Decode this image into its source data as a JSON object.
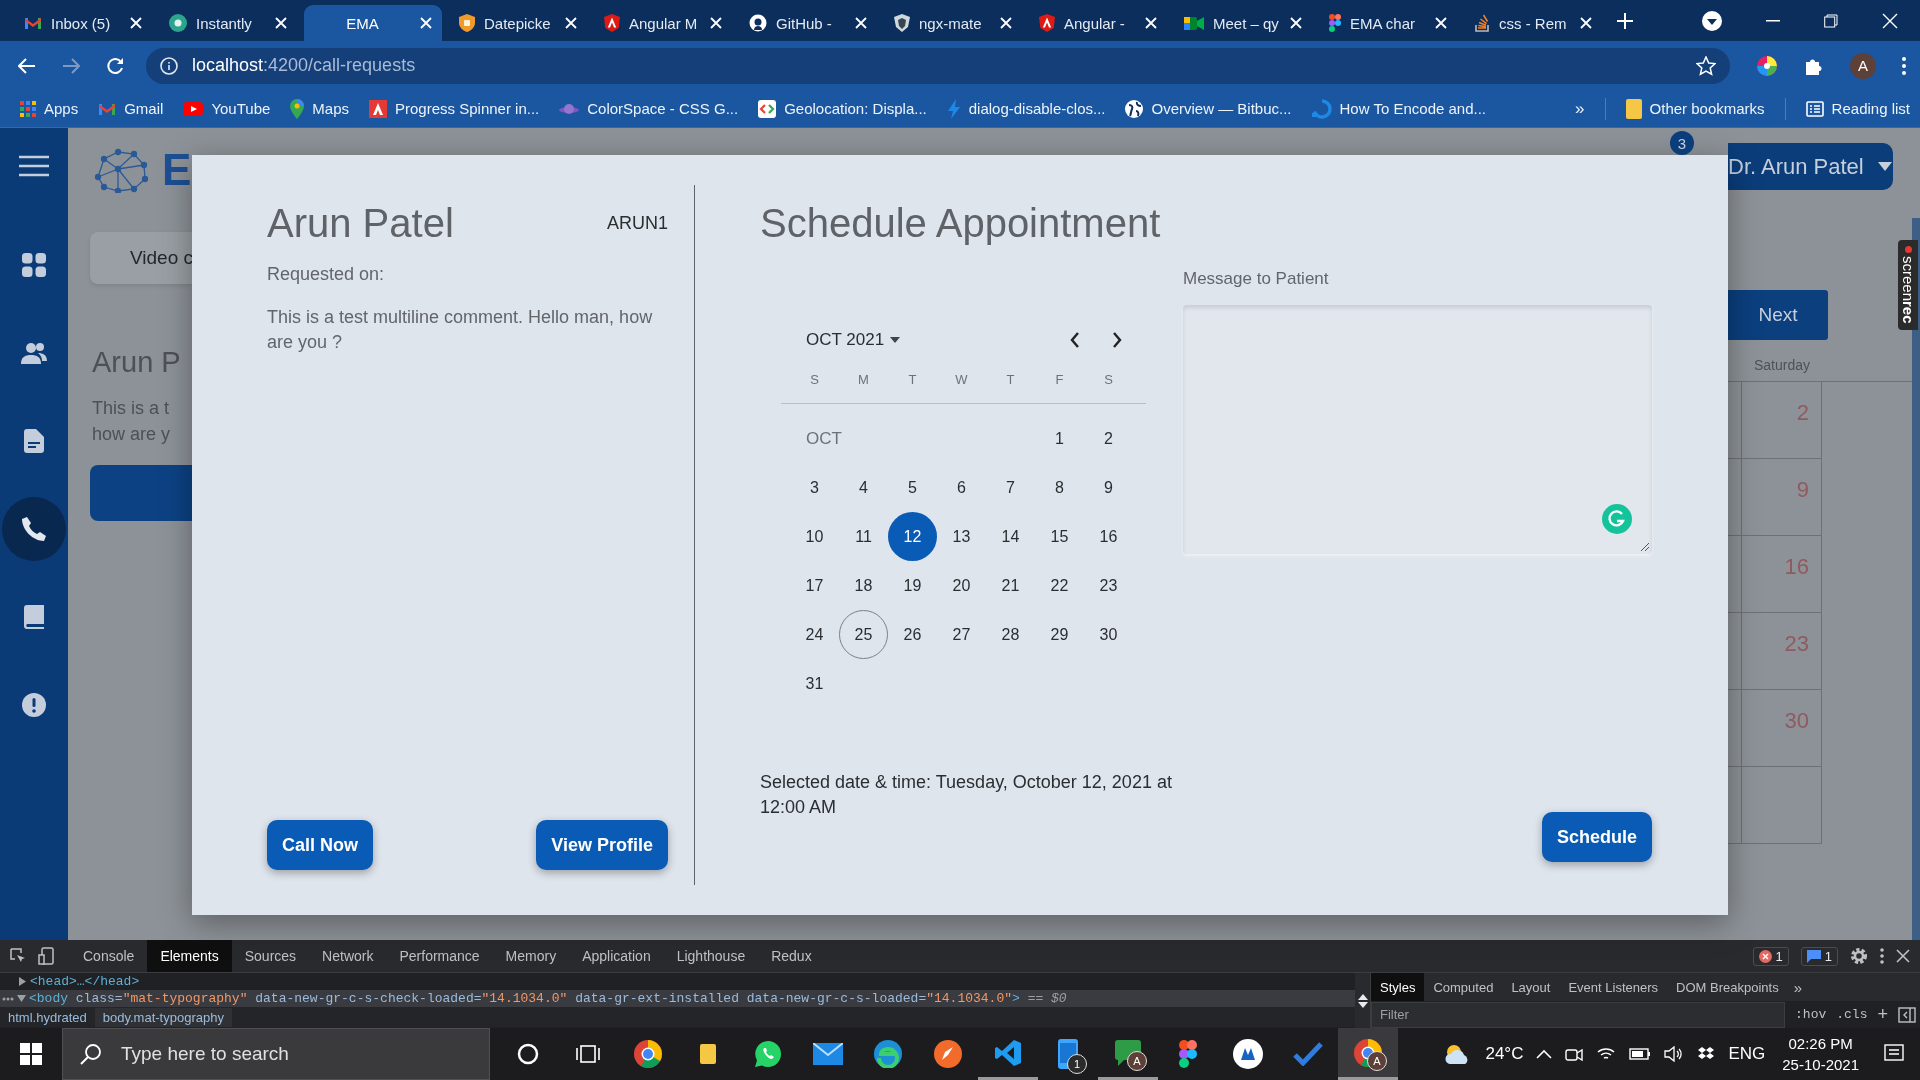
{
  "browser": {
    "tabs": [
      {
        "title": "Inbox (5)",
        "kind": "gmail",
        "selected": false
      },
      {
        "title": "Instantly",
        "kind": "qt",
        "selected": false
      },
      {
        "title": "EMA",
        "kind": "none",
        "selected": true
      },
      {
        "title": "Datepicke",
        "kind": "shield",
        "selected": false
      },
      {
        "title": "Angular M",
        "kind": "angular",
        "selected": false
      },
      {
        "title": "GitHub -",
        "kind": "github",
        "selected": false
      },
      {
        "title": "ngx-mate",
        "kind": "ngx",
        "selected": false
      },
      {
        "title": "Angular -",
        "kind": "angular",
        "selected": false
      },
      {
        "title": "Meet – qy",
        "kind": "meet",
        "selected": false
      },
      {
        "title": "EMA char",
        "kind": "figma",
        "selected": false
      },
      {
        "title": "css - Rem",
        "kind": "stack",
        "selected": false
      }
    ],
    "url_host": "localhost",
    "url_rest": ":4200/call-requests",
    "profile_initial": "A",
    "bookmarks": [
      {
        "label": "Apps",
        "kind": "apps"
      },
      {
        "label": "Gmail",
        "kind": "gmail"
      },
      {
        "label": "YouTube",
        "kind": "youtube"
      },
      {
        "label": "Maps",
        "kind": "maps"
      },
      {
        "label": "Progress Spinner in...",
        "kind": "doc"
      },
      {
        "label": "ColorSpace - CSS G...",
        "kind": "planet"
      },
      {
        "label": "Geolocation: Displa...",
        "kind": "code"
      },
      {
        "label": "dialog-disable-clos...",
        "kind": "bolt"
      },
      {
        "label": "Overview — Bitbuc...",
        "kind": "globe"
      },
      {
        "label": "How To Encode and...",
        "kind": "ring"
      }
    ],
    "bookmarks_overflow": "»",
    "other_bookmarks": [
      {
        "label": "Other bookmarks",
        "kind": "folder"
      },
      {
        "label": "Reading list",
        "kind": "list"
      }
    ]
  },
  "sidebar": {
    "items": [
      {
        "kind": "menu",
        "selected": false
      },
      {
        "kind": "grid",
        "selected": false
      },
      {
        "kind": "people",
        "selected": false
      },
      {
        "kind": "document",
        "selected": false
      },
      {
        "kind": "phone",
        "selected": true
      },
      {
        "kind": "book",
        "selected": false
      },
      {
        "kind": "info",
        "selected": false
      }
    ]
  },
  "background_page": {
    "logo_text": "E",
    "tab_label": "Video c",
    "patient_name": "Arun P",
    "comment": "This is a t\nhow are y",
    "notification_count": "3",
    "user_menu": "Dr. Arun Patel",
    "next_button": "Next",
    "weekday_header": "Saturday",
    "dates": [
      {
        "label": "2"
      },
      {
        "label": "9"
      },
      {
        "label": "16"
      },
      {
        "label": "23"
      },
      {
        "label": "30"
      }
    ]
  },
  "dialog": {
    "patient_name": "Arun Patel",
    "patient_id": "ARUN1",
    "requested_on": "Requested on:",
    "comment": "This is a test multiline comment. Hello man, how are you ?",
    "call_button": "Call Now",
    "profile_button": "View Profile",
    "title": "Schedule Appointment",
    "calendar": {
      "month_year": "OCT 2021",
      "weekdays": [
        "S",
        "M",
        "T",
        "W",
        "T",
        "F",
        "S"
      ],
      "month_label": "OCT",
      "weeks": [
        {
          "days": [
            {
              "label": "1",
              "selected": false,
              "today": false
            },
            {
              "label": "2",
              "selected": false,
              "today": false
            }
          ]
        },
        {
          "days": [
            {
              "label": "3",
              "selected": false,
              "today": false
            },
            {
              "label": "4",
              "selected": false,
              "today": false
            },
            {
              "label": "5",
              "selected": false,
              "today": false
            },
            {
              "label": "6",
              "selected": false,
              "today": false
            },
            {
              "label": "7",
              "selected": false,
              "today": false
            },
            {
              "label": "8",
              "selected": false,
              "today": false
            },
            {
              "label": "9",
              "selected": false,
              "today": false
            }
          ]
        },
        {
          "days": [
            {
              "label": "10",
              "selected": false,
              "today": false
            },
            {
              "label": "11",
              "selected": false,
              "today": false
            },
            {
              "label": "12",
              "selected": true,
              "today": false
            },
            {
              "label": "13",
              "selected": false,
              "today": false
            },
            {
              "label": "14",
              "selected": false,
              "today": false
            },
            {
              "label": "15",
              "selected": false,
              "today": false
            },
            {
              "label": "16",
              "selected": false,
              "today": false
            }
          ]
        },
        {
          "days": [
            {
              "label": "17",
              "selected": false,
              "today": false
            },
            {
              "label": "18",
              "selected": false,
              "today": false
            },
            {
              "label": "19",
              "selected": false,
              "today": false
            },
            {
              "label": "20",
              "selected": false,
              "today": false
            },
            {
              "label": "21",
              "selected": false,
              "today": false
            },
            {
              "label": "22",
              "selected": false,
              "today": false
            },
            {
              "label": "23",
              "selected": false,
              "today": false
            }
          ]
        },
        {
          "days": [
            {
              "label": "24",
              "selected": false,
              "today": false
            },
            {
              "label": "25",
              "selected": false,
              "today": true
            },
            {
              "label": "26",
              "selected": false,
              "today": false
            },
            {
              "label": "27",
              "selected": false,
              "today": false
            },
            {
              "label": "28",
              "selected": false,
              "today": false
            },
            {
              "label": "29",
              "selected": false,
              "today": false
            },
            {
              "label": "30",
              "selected": false,
              "today": false
            }
          ]
        },
        {
          "days": [
            {
              "label": "31",
              "selected": false,
              "today": false
            }
          ]
        }
      ]
    },
    "message_label": "Message to Patient",
    "selected_text": "Selected date & time: Tuesday, October 12, 2021 at 12:00 AM",
    "schedule_button": "Schedule"
  },
  "screenrec_tag": "screen**rec**",
  "devtools": {
    "tabs": [
      {
        "label": "Console",
        "selected": false
      },
      {
        "label": "Elements",
        "selected": true
      },
      {
        "label": "Sources",
        "selected": false
      },
      {
        "label": "Network",
        "selected": false
      },
      {
        "label": "Performance",
        "selected": false
      },
      {
        "label": "Memory",
        "selected": false
      },
      {
        "label": "Application",
        "selected": false
      },
      {
        "label": "Lighthouse",
        "selected": false
      },
      {
        "label": "Redux",
        "selected": false
      }
    ],
    "error_count": "1",
    "message_count": "1",
    "lines": [
      {
        "expanded": false,
        "selected": false,
        "segments": [
          {
            "kind": "tag",
            "text": "<head>…</head>"
          }
        ]
      },
      {
        "expanded": true,
        "selected": true,
        "segments": [
          {
            "kind": "tag",
            "text": "<body"
          },
          {
            "kind": "attr",
            "text": " class="
          },
          {
            "kind": "value",
            "text": "\"mat-typography\""
          },
          {
            "kind": "attr",
            "text": " data-new-gr-c-s-check-loaded="
          },
          {
            "kind": "value",
            "text": "\"14.1034.0\""
          },
          {
            "kind": "attr",
            "text": " data-gr-ext-installed data-new-gr-c-s-loaded="
          },
          {
            "kind": "value",
            "text": "\"14.1034.0\""
          },
          {
            "kind": "tag",
            "text": ">"
          },
          {
            "kind": "note",
            "text": " == $0"
          }
        ]
      }
    ],
    "breadcrumbs": [
      {
        "label": "html.hydrated",
        "selected": false
      },
      {
        "label": "body.mat-typography",
        "selected": true
      }
    ],
    "side_tabs": [
      {
        "label": "Styles",
        "selected": true
      },
      {
        "label": "Computed",
        "selected": false
      },
      {
        "label": "Layout",
        "selected": false
      },
      {
        "label": "Event Listeners",
        "selected": false
      },
      {
        "label": "DOM Breakpoints",
        "selected": false
      }
    ],
    "side_overflow": "»",
    "filter_placeholder": "Filter",
    "hov": ":hov",
    "cls": ".cls",
    "add": "+"
  },
  "taskbar": {
    "search_placeholder": "Type here to search",
    "apps": [
      {
        "kind": "cortana",
        "open": false
      },
      {
        "kind": "taskview",
        "open": false
      },
      {
        "kind": "chrome",
        "open": false
      },
      {
        "kind": "folder",
        "open": false
      },
      {
        "kind": "whatsapp",
        "open": false
      },
      {
        "kind": "mail",
        "open": false
      },
      {
        "kind": "edge",
        "open": false
      },
      {
        "kind": "pen",
        "open": false
      },
      {
        "kind": "vscode",
        "open": true
      },
      {
        "kind": "phone",
        "badge": "1",
        "open": false
      },
      {
        "kind": "chat",
        "badge": "A",
        "open": true
      },
      {
        "kind": "figma",
        "open": false
      },
      {
        "kind": "whiteapp",
        "open": false
      },
      {
        "kind": "check",
        "open": false
      },
      {
        "kind": "chrome",
        "badge": "A",
        "open": true
      }
    ],
    "temperature": "24°C",
    "language": "ENG",
    "time": "02:26 PM",
    "date": "25-10-2021"
  }
}
